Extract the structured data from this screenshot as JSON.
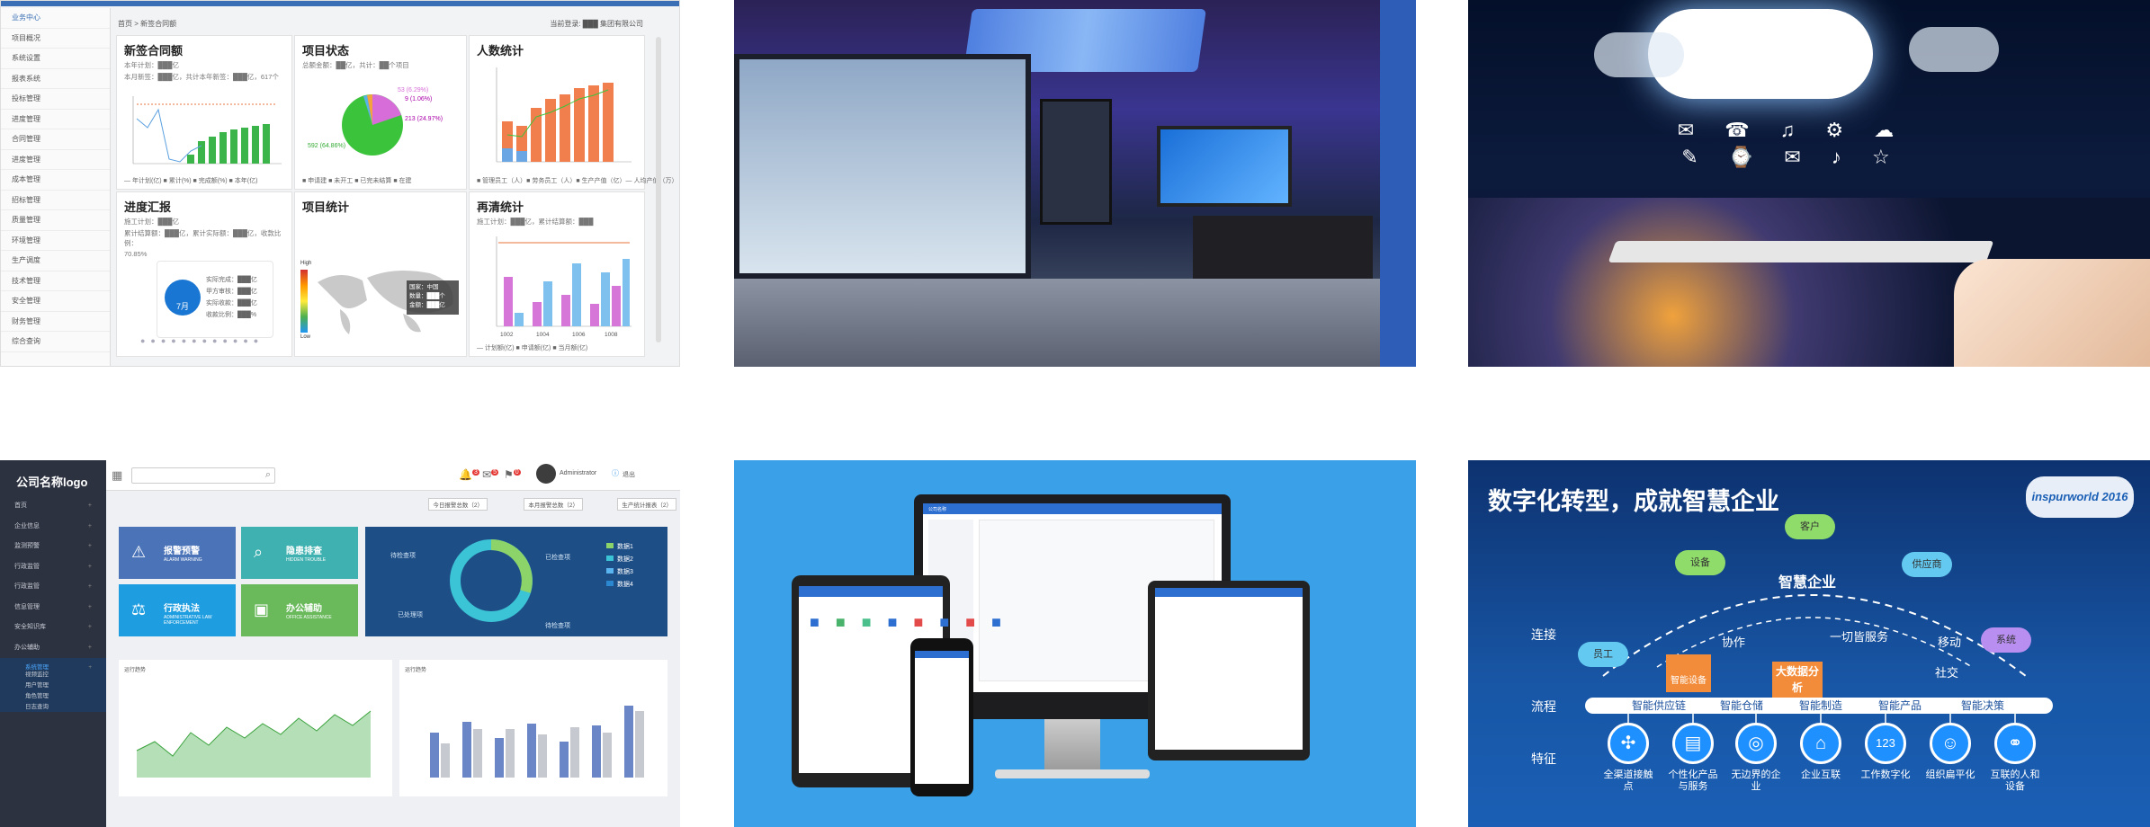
{
  "dashboard": {
    "sidebar": [
      "业务中心",
      "项目概况",
      "系统设置",
      "报表系统",
      "投标管理",
      "进度管理",
      "合同管理",
      "进度管理",
      "成本管理",
      "招标管理",
      "质量管理",
      "环境管理",
      "生产调度",
      "技术管理",
      "安全管理",
      "财务管理",
      "综合查询"
    ],
    "breadcrumb": "首页 > 新签合同额",
    "user": "当前登录: ███ 集团有限公司",
    "cards": {
      "c1": {
        "title": "新签合同额",
        "line1": "本年计划：███亿",
        "line2": "本月新签：███亿，共计本年新签：███亿，617个"
      },
      "c2": {
        "title": "项目状态",
        "line1": "总额金额：██亿，共计：██个项目",
        "labels": [
          "53 (6.29%)",
          "9 (1.06%)",
          "213 (24.97%)",
          "592 (64.86%)"
        ],
        "legend": "■ 申请建  ■ 未开工  ■ 已完未结算  ■ 在建"
      },
      "c3": {
        "title": "人数统计",
        "legend": "■ 管理员工（人）■ 劳务员工（人）■ 生产产值（亿）— 人均产值（万）"
      },
      "c4": {
        "title": "进度汇报",
        "line1": "施工计划：███亿",
        "line2": "累计结算额：███亿，累计实际额：███亿，收款比例：",
        "line3": "70.85%",
        "month": "7月",
        "items": [
          "实际完成：███亿",
          "甲方审核：███亿",
          "实际收款：███亿",
          "收款比例：███%"
        ]
      },
      "c5": {
        "title": "项目统计",
        "tooltip": [
          "国家：中国",
          "数量：███个",
          "金额：███亿"
        ],
        "high": "High",
        "low": "Low"
      },
      "c6": {
        "title": "再清统计",
        "line1": "施工计划：███亿，累计结算额：███",
        "legend": "— 计划额(亿) ■ 申请额(亿) ■ 当月额(亿)",
        "xticks": [
          "1002",
          "1004",
          "1006",
          "1008"
        ]
      }
    }
  },
  "admin": {
    "brand": "公司名称logo",
    "nav": [
      "首页",
      "企业信息",
      "监测预警",
      "行政监管",
      "行政监管",
      "信息管理",
      "安全知识库",
      "办公辅助",
      "系统管理"
    ],
    "subnav": [
      "视频监控",
      "用户管理",
      "角色管理",
      "日志查询"
    ],
    "user": "Administrator",
    "logout": "退出",
    "badges": [
      "3",
      "5",
      "0"
    ],
    "filters": [
      "今日报警总数（2）",
      "本月报警总数（2）",
      "生产统计报表（2）"
    ],
    "tiles": [
      {
        "title": "报警预警",
        "sub": "ALARM WARNING",
        "color": "#4a73b8"
      },
      {
        "title": "隐患排查",
        "sub": "HIDDEN TROUBLE",
        "color": "#3fb1b0"
      },
      {
        "title": "行政执法",
        "sub": "ADMINISTRATIVE LAW ENFORCEMENT",
        "color": "#1e9de0"
      },
      {
        "title": "办公辅助",
        "sub": "OFFICE ASSISTANCE",
        "color": "#6aba5c"
      }
    ],
    "donut_labels": [
      "待检查项",
      "已检查项",
      "已处理项",
      "待检查项"
    ],
    "donut_legend": [
      "数据1",
      "数据2",
      "数据3",
      "数据4"
    ],
    "panel_titles": [
      "运行趋势",
      "运行趋势"
    ]
  },
  "devices": {
    "app_name": "公司名称"
  },
  "digital": {
    "title": "数字化转型，成就智慧企业",
    "logo": "inspurworld 2016",
    "center": "智慧企业",
    "rows": [
      "连接",
      "流程",
      "特征"
    ],
    "clouds": [
      "设备",
      "客户",
      "供应商",
      "员工",
      "系统"
    ],
    "connect": [
      "协作",
      "一切皆服务",
      "移动",
      "社交",
      "大数据分析",
      "智能设备"
    ],
    "flows": [
      "智能供应链",
      "智能仓储",
      "智能制造",
      "智能产品",
      "智能决策"
    ],
    "features": [
      {
        "label": "全渠道接触点",
        "icon": "network-icon"
      },
      {
        "label": "个性化产品与服务",
        "icon": "calendar-icon"
      },
      {
        "label": "无边界的企业",
        "icon": "globe-icon"
      },
      {
        "label": "企业互联",
        "icon": "house-icon"
      },
      {
        "label": "工作数字化",
        "icon": "digits-icon"
      },
      {
        "label": "组织扁平化",
        "icon": "people-icon"
      },
      {
        "label": "互联的人和设备",
        "icon": "share-icon"
      }
    ],
    "feature_digits": "123"
  }
}
